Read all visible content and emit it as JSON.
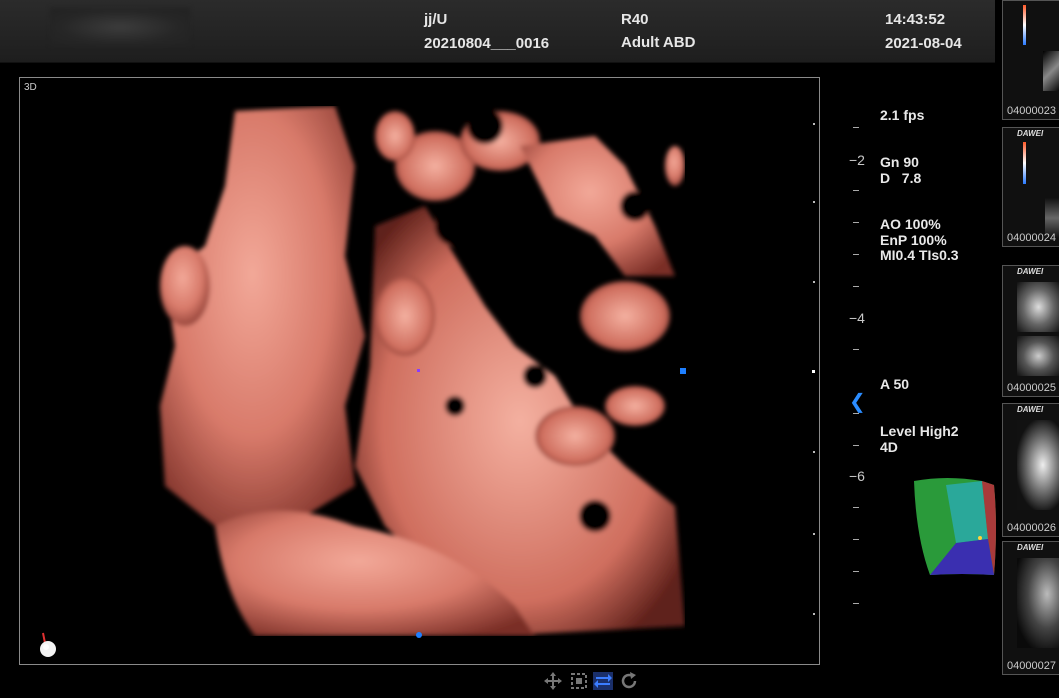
{
  "header": {
    "operator": "jj/U",
    "exam_id": "20210804___0016",
    "probe": "R40",
    "preset": "Adult ABD",
    "time": "14:43:52",
    "date": "2021-08-04"
  },
  "viewport": {
    "mode_label": "3D"
  },
  "params": {
    "fps": "2.1 fps",
    "gain": "Gn  90",
    "depth": "D   7.8",
    "ao": "AO  100%",
    "enp": "EnP 100%",
    "mi_tis": "MI0.4 TIs0.3",
    "a": "A  50",
    "level": "Level High2",
    "mode4d": "4D"
  },
  "ruler": {
    "labels": [
      "−2",
      "−4",
      "−6"
    ]
  },
  "thumbnails": [
    {
      "label": "04000023",
      "brand": ""
    },
    {
      "label": "04000024",
      "brand": "DAWEI"
    },
    {
      "label": "04000025",
      "brand": "DAWEI"
    },
    {
      "label": "04000026",
      "brand": "DAWEI"
    },
    {
      "label": "04000027",
      "brand": "DAWEI"
    }
  ],
  "toolbar": {
    "icons": [
      "move-icon",
      "zoom-fit-icon",
      "swap-icon",
      "rotate-icon"
    ],
    "active_color": "#2b6fe0"
  },
  "colors": {
    "accent": "#1e7fff",
    "tissue": "#e08a78"
  }
}
